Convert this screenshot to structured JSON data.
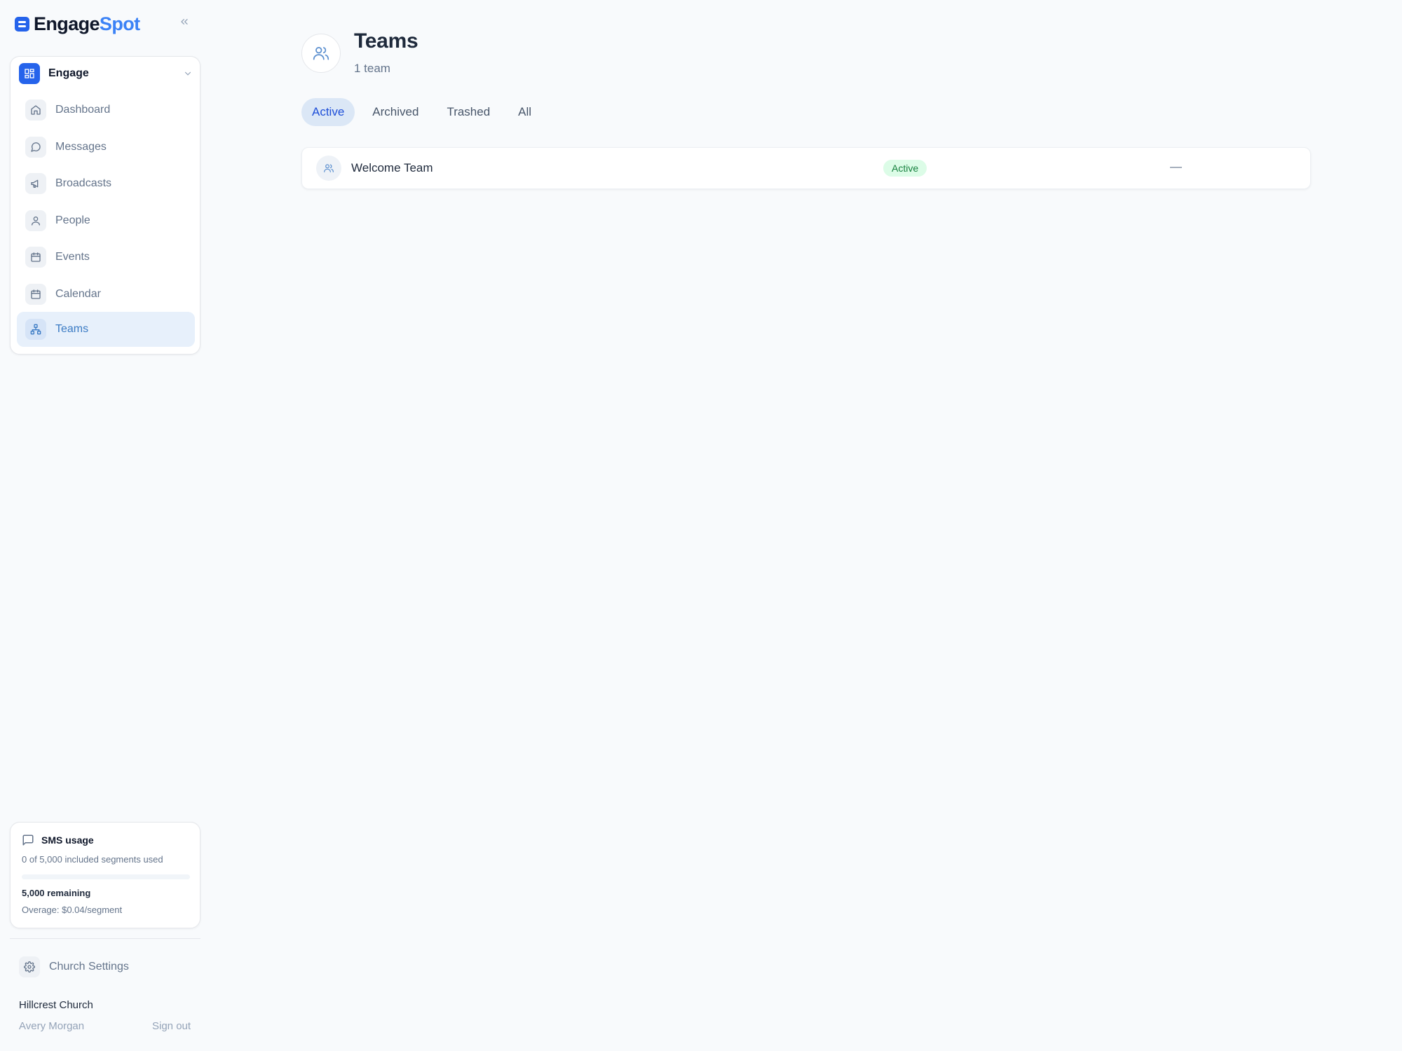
{
  "brand": {
    "name_part1": "Engage",
    "name_part2": "Spot",
    "primary_color": "#2563eb",
    "accent_color": "#3b82f6"
  },
  "sidebar": {
    "collapse_icon": "chevrons-left-icon",
    "workspace": {
      "label": "Engage",
      "icon": "grid-icon"
    },
    "items": [
      {
        "label": "Dashboard",
        "icon": "home-icon",
        "active": false
      },
      {
        "label": "Messages",
        "icon": "message-circle-icon",
        "active": false
      },
      {
        "label": "Broadcasts",
        "icon": "megaphone-icon",
        "active": false
      },
      {
        "label": "People",
        "icon": "user-icon",
        "active": false
      },
      {
        "label": "Events",
        "icon": "calendar-icon",
        "active": false
      },
      {
        "label": "Calendar",
        "icon": "calendar-icon",
        "active": false
      },
      {
        "label": "Teams",
        "icon": "network-icon",
        "active": true
      }
    ],
    "sms_usage": {
      "title": "SMS usage",
      "description": "0 of 5,000 included segments used",
      "used_fraction": 0,
      "remaining": "5,000 remaining",
      "overage": "Overage: $0.04/segment"
    },
    "settings_label": "Church Settings",
    "church_name": "Hillcrest Church",
    "user_name": "Avery Morgan",
    "signout_label": "Sign out"
  },
  "main": {
    "title": "Teams",
    "subtitle": "1 team",
    "tabs": [
      {
        "label": "Active",
        "active": true
      },
      {
        "label": "Archived",
        "active": false
      },
      {
        "label": "Trashed",
        "active": false
      },
      {
        "label": "All",
        "active": false
      }
    ],
    "teams": [
      {
        "name": "Welcome Team",
        "status": "Active",
        "extra": "—"
      }
    ]
  }
}
